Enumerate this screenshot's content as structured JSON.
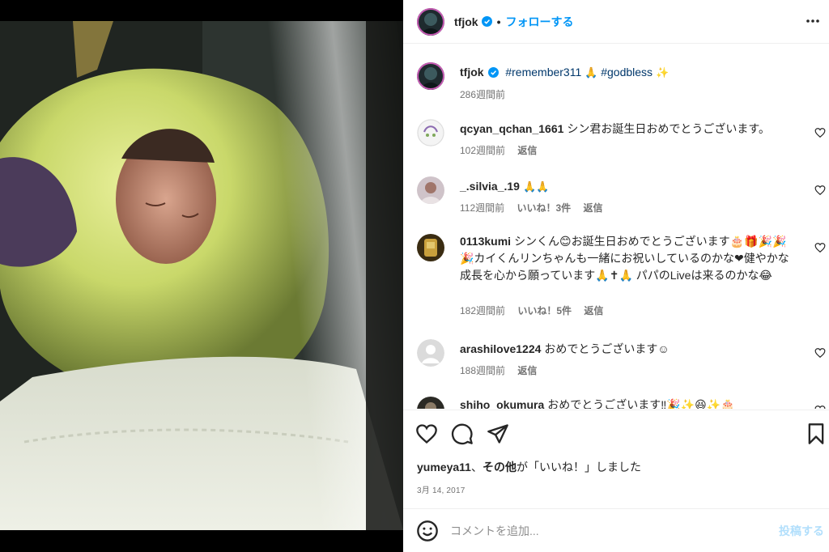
{
  "header": {
    "username": "tfjok",
    "dot": "•",
    "follow_label": "フォローする"
  },
  "caption": {
    "username": "tfjok",
    "tags": [
      "#remember311",
      "#godbless"
    ],
    "emojis": [
      "🙏",
      "✨"
    ],
    "time": "286週間前"
  },
  "comments": [
    {
      "username": "qcyan_qchan_1661",
      "text": "シン君お誕生日おめでとうございます。",
      "time": "102週間前",
      "likes": "",
      "reply": "返信"
    },
    {
      "username": "_.silvia_.19",
      "text": "🙏🙏",
      "time": "112週間前",
      "likes": "いいね！3件",
      "reply": "返信"
    },
    {
      "username": "0113kumi",
      "text": "シンくん😊お誕生日おめでとうございます🎂🎁🎉🎉🎉カイくんリンちゃんも一緒にお祝いしているのかな❤健やかな成長を心から願っています🙏✝🙏 パパのLiveは来るのかな😂",
      "time": "182週間前",
      "likes": "いいね！5件",
      "reply": "返信"
    },
    {
      "username": "arashilove1224",
      "text": "おめでとうございます☺",
      "time": "188週間前",
      "likes": "",
      "reply": "返信"
    },
    {
      "username": "shiho_okumura",
      "text": "おめでとうございます‼🎉✨😆✨🎂",
      "time": "",
      "likes": "",
      "reply": ""
    }
  ],
  "likes_line": {
    "user": "yumeya11",
    "sep": "、",
    "others": "その他",
    "suffix": "が「いいね！」しました"
  },
  "date": "3月 14, 2017",
  "composer": {
    "placeholder": "コメントを追加...",
    "post_label": "投稿する"
  },
  "colors": {
    "accent": "#0095f6",
    "link": "#00376b",
    "muted": "#737373",
    "post_disabled": "#b2dffc"
  },
  "icons": [
    "verified-badge-icon",
    "more-options-icon",
    "heart-icon",
    "comment-icon",
    "share-icon",
    "bookmark-icon",
    "emoji-icon"
  ]
}
